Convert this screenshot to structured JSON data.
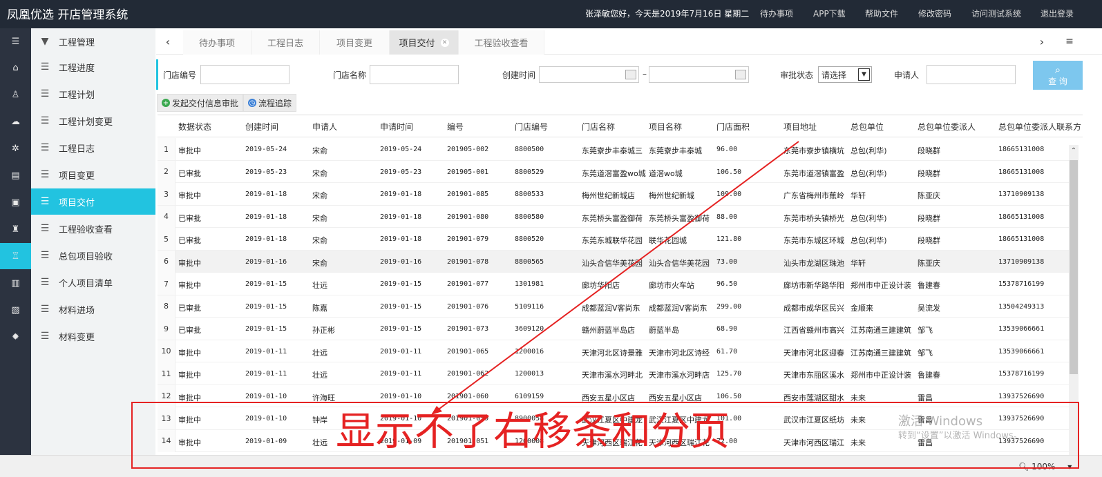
{
  "app": {
    "title": "凤凰优选 开店管理系统"
  },
  "header": {
    "greeting": "张泽敏您好，今天是2019年7月16日  星期二",
    "links": [
      "待办事项",
      "APP下载",
      "帮助文件",
      "修改密码",
      "访问测试系统",
      "退出登录"
    ]
  },
  "rail_icons": [
    "menu-icon",
    "home-icon",
    "user-icon",
    "group-icon",
    "network-icon",
    "calendar-icon",
    "monitor-icon",
    "worker-icon",
    "building-icon",
    "document-icon",
    "report-icon",
    "settings-icon"
  ],
  "menu": {
    "header": "工程管理",
    "items": [
      "工程进度",
      "工程计划",
      "工程计划变更",
      "工程日志",
      "项目变更",
      "项目交付",
      "工程验收查看",
      "总包项目验收",
      "个人项目清单",
      "材料进场",
      "材料变更"
    ],
    "active": "项目交付"
  },
  "tabs": {
    "items": [
      "待办事项",
      "工程日志",
      "项目变更",
      "项目交付",
      "工程验收查看"
    ],
    "active": "项目交付"
  },
  "filter": {
    "store_code_label": "门店编号",
    "store_name_label": "门店名称",
    "created_label": "创建时间",
    "date_sep": "–",
    "approval_label": "审批状态",
    "approval_value": "请选择",
    "applicant_label": "申请人",
    "query_label": "查 询"
  },
  "actions": {
    "submit": "发起交付信息审批",
    "trace": "流程追踪"
  },
  "table": {
    "columns": [
      "数据状态",
      "创建时间",
      "申请人",
      "申请时间",
      "编号",
      "门店编号",
      "门店名称",
      "项目名称",
      "门店面积",
      "项目地址",
      "总包单位",
      "总包单位委派人",
      "总包单位委派人联系方"
    ],
    "rows": [
      [
        "1",
        "审批中",
        "2019-05-24",
        "宋俞",
        "2019-05-24",
        "201905-002",
        "8800500",
        "东莞寮步丰泰城三",
        "东莞寮步丰泰城",
        "96.00",
        "东莞市寮步镇横坑",
        "总包(利华)",
        "段晓群",
        "18665131008"
      ],
      [
        "2",
        "已审批",
        "2019-05-23",
        "宋俞",
        "2019-05-23",
        "201905-001",
        "8800529",
        "东莞道滘富盈wo城",
        "道滘wo城",
        "106.50",
        "东莞市道滘镇富盈",
        "总包(利华)",
        "段晓群",
        "18665131008"
      ],
      [
        "3",
        "审批中",
        "2019-01-18",
        "宋俞",
        "2019-01-18",
        "201901-085",
        "8800533",
        "梅州世纪新城店",
        "梅州世纪新城",
        "109.00",
        "广东省梅州市蕉岭",
        "华轩",
        "陈亚庆",
        "13710909138"
      ],
      [
        "4",
        "已审批",
        "2019-01-18",
        "宋俞",
        "2019-01-18",
        "201901-080",
        "8800580",
        "东莞桥头富盈御荷",
        "东莞桥头富盈御荷",
        "88.00",
        "东莞市桥头镇桥光",
        "总包(利华)",
        "段晓群",
        "18665131008"
      ],
      [
        "5",
        "已审批",
        "2019-01-18",
        "宋俞",
        "2019-01-18",
        "201901-079",
        "8800520",
        "东莞东城联华花园",
        "联华花园城",
        "121.80",
        "东莞市东城区环城",
        "总包(利华)",
        "段晓群",
        "18665131008"
      ],
      [
        "6",
        "审批中",
        "2019-01-16",
        "宋俞",
        "2019-01-16",
        "201901-078",
        "8800565",
        "汕头合信华美花园",
        "汕头合信华美花园",
        "73.00",
        "汕头市龙湖区珠池",
        "华轩",
        "陈亚庆",
        "13710909138"
      ],
      [
        "7",
        "审批中",
        "2019-01-15",
        "壮远",
        "2019-01-15",
        "201901-077",
        "1301981",
        "廊坊华阳店",
        "廊坊市火车站",
        "96.50",
        "廊坊市新华路华阳",
        "郑州市中正设计装",
        "鲁建春",
        "15378716199"
      ],
      [
        "8",
        "已审批",
        "2019-01-15",
        "陈嘉",
        "2019-01-15",
        "201901-076",
        "5109116",
        "成都蓝润V客尚东",
        "成都蓝润V客尚东",
        "299.00",
        "成都市成华区民兴",
        "金顺来",
        "吴流发",
        "13504249313"
      ],
      [
        "9",
        "已审批",
        "2019-01-15",
        "孙正彬",
        "2019-01-15",
        "201901-073",
        "3609120",
        "赣州蔚蓝半岛店",
        "蔚蓝半岛",
        "68.90",
        "江西省赣州市高兴",
        "江苏南通三建建筑",
        "邹飞",
        "13539066661"
      ],
      [
        "10",
        "审批中",
        "2019-01-11",
        "壮远",
        "2019-01-11",
        "201901-065",
        "1200016",
        "天津河北区诗景雅",
        "天津市河北区诗经",
        "61.70",
        "天津市河北区迎春",
        "江苏南通三建建筑",
        "邹飞",
        "13539066661"
      ],
      [
        "11",
        "审批中",
        "2019-01-11",
        "壮远",
        "2019-01-11",
        "201901-062",
        "1200013",
        "天津市溪水河畔北",
        "天津市溪水河畔店",
        "125.70",
        "天津市东丽区溪水",
        "郑州市中正设计装",
        "鲁建春",
        "15378716199"
      ],
      [
        "12",
        "审批中",
        "2019-01-10",
        "许海旺",
        "2019-01-10",
        "201901-060",
        "6109159",
        "西安五星小区店",
        "西安五星小区店",
        "106.50",
        "西安市莲湖区甜水",
        "未来",
        "雷昌",
        "13937526690"
      ],
      [
        "13",
        "审批中",
        "2019-01-10",
        "钟岸",
        "2019-01-10",
        "201901-059",
        "8900058",
        "武汉江夏区中建龙",
        "武汉江夏区中建龙",
        "101.00",
        "武汉市江夏区纸坊",
        "未来",
        "雷昌",
        "13937526690"
      ],
      [
        "14",
        "审批中",
        "2019-01-09",
        "壮远",
        "2019-01-09",
        "201901-051",
        "1200008",
        "天津河西区瑞江花",
        "天津河西区瑞江花",
        "72.00",
        "天津市河西区瑞江",
        "未来",
        "雷昌",
        "13937526690"
      ]
    ]
  },
  "status": {
    "zoom": "100%"
  },
  "annotation": {
    "text": "显示不了右移条和分页",
    "color": "#e52222"
  },
  "watermark": {
    "line1": "激活 Windows",
    "line2": "转到“设置”以激活 Windows。"
  },
  "colors": {
    "accent": "#22c3e0",
    "header_bg": "#222a36",
    "annotation": "#e52222"
  }
}
